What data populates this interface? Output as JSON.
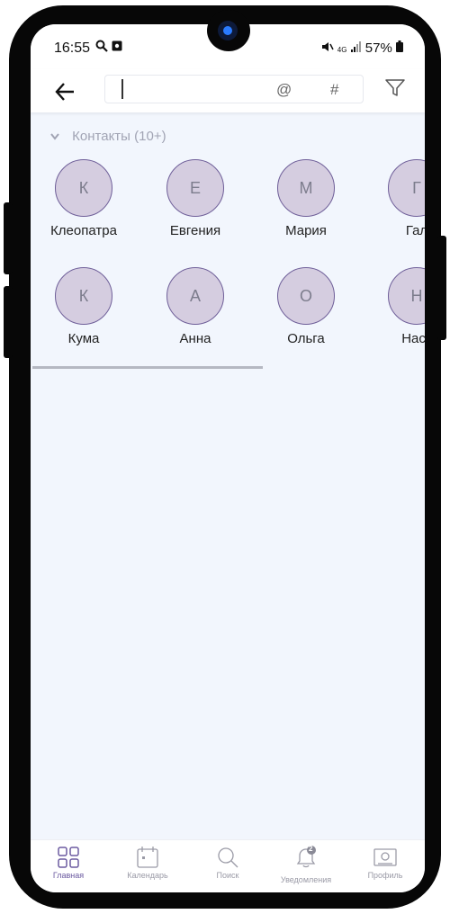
{
  "status_bar": {
    "time": "16:55",
    "network": "4G",
    "battery": "57%"
  },
  "search": {
    "value": "",
    "at_symbol": "@",
    "hash_symbol": "#"
  },
  "section": {
    "title": "Контакты (10+)"
  },
  "contacts": [
    {
      "initial": "К",
      "name": "Клеопатра"
    },
    {
      "initial": "Е",
      "name": "Евгения"
    },
    {
      "initial": "М",
      "name": "Мария"
    },
    {
      "initial": "Г",
      "name": "Гал"
    },
    {
      "initial": "К",
      "name": "Кума"
    },
    {
      "initial": "А",
      "name": "Анна"
    },
    {
      "initial": "О",
      "name": "Ольга"
    },
    {
      "initial": "Н",
      "name": "Наст"
    }
  ],
  "bottom_nav": [
    {
      "label": "Главная",
      "icon": "home-grid-icon",
      "active": true
    },
    {
      "label": "Календарь",
      "icon": "calendar-icon",
      "active": false
    },
    {
      "label": "Поиск",
      "icon": "search-icon",
      "active": false
    },
    {
      "label": "Уведомления",
      "icon": "bell-icon",
      "badge": "2",
      "active": false
    },
    {
      "label": "Профиль",
      "icon": "profile-card-icon",
      "active": false
    }
  ],
  "colors": {
    "background": "#f2f6fd",
    "avatar_fill": "#d5cde0",
    "avatar_border": "#6f5f99",
    "accent": "#6b5aa0"
  }
}
